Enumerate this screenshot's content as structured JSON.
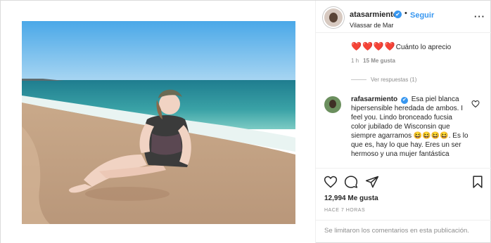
{
  "header": {
    "username": "atasarmiento",
    "verified_mark": "✔",
    "separator": "•",
    "follow_label": "Seguir",
    "location": "Vilassar de Mar",
    "more_glyph": "···"
  },
  "comment1": {
    "hearts": "❤️❤️❤️❤️",
    "text": "Cuánto lo aprecio",
    "time": "1 h",
    "likes": "15 Me gusta",
    "view_replies": "Ver respuestas (1)"
  },
  "comment2": {
    "username": "rafasarmiento",
    "verified_mark": "✔",
    "text": "Esa piel blanca hipersensible heredada de ambos. I feel you. Lindo bronceado fucsia color jubilado de Wisconsin que siempre agarramos 😆😆😆😆. Es lo que es, hay lo que hay. Eres un ser hermoso y una mujer fantástica"
  },
  "actions": {
    "like_count": "12,994 Me gusta",
    "time_ago": "HACE 7 HORAS"
  },
  "footer": {
    "comments_limited": "Se limitaron los comentarios en esta publicación."
  },
  "icons": {
    "like": "heart-outline-icon",
    "comment": "comment-bubble-icon",
    "share": "paper-plane-icon",
    "save": "bookmark-icon"
  },
  "colors": {
    "accent": "#3897f0",
    "heart_red": "#ed4956",
    "muted": "#8e8e8e",
    "text": "#262626"
  }
}
